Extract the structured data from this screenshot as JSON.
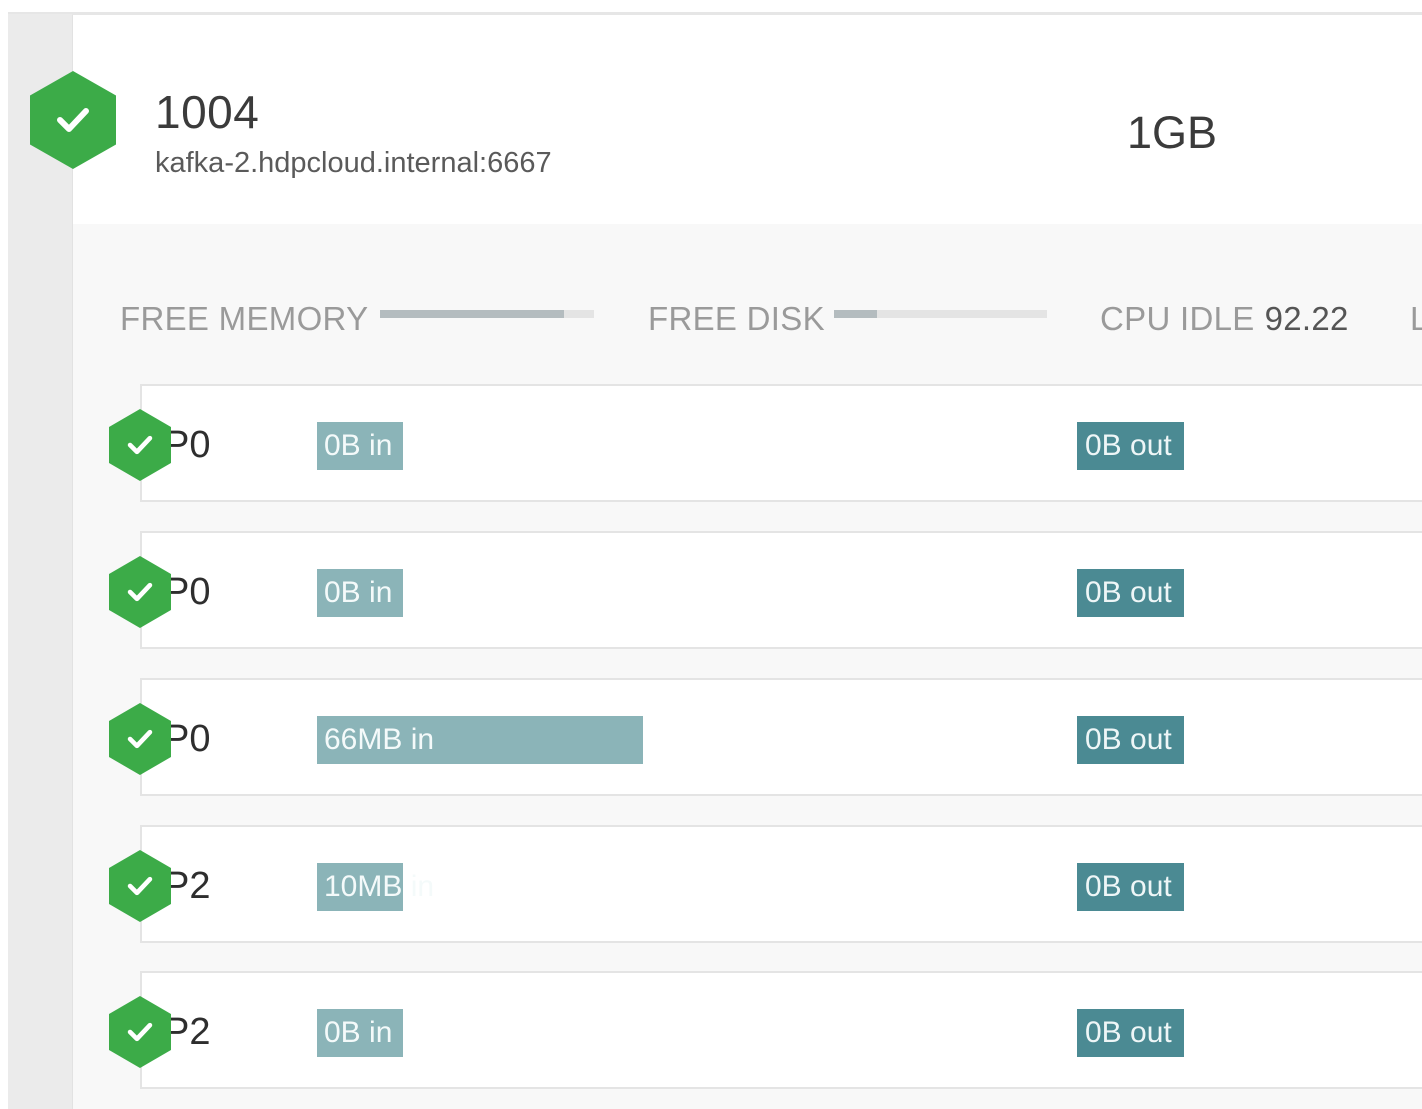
{
  "broker": {
    "id": "1004",
    "host": "kafka-2.hdpcloud.internal:6667",
    "memory": "1GB",
    "status": "ok"
  },
  "metrics": {
    "free_memory_label": "FREE MEMORY",
    "free_memory_fraction": 0.86,
    "free_disk_label": "FREE DISK",
    "free_disk_fraction": 0.2,
    "cpu_idle_label": "CPU IDLE",
    "cpu_idle_value": "92.22",
    "next_label_partial": "L"
  },
  "partitions": [
    {
      "name": "P0",
      "in_label": "0B in",
      "in_fraction": 0.0,
      "out_label": "0B out"
    },
    {
      "name": "P0",
      "in_label": "0B in",
      "in_fraction": 0.0,
      "out_label": "0B out"
    },
    {
      "name": "P0",
      "in_label": "66MB in",
      "in_fraction": 1.0,
      "out_label": "0B out"
    },
    {
      "name": "P2",
      "in_label": "10MB in",
      "in_fraction": 0.15,
      "out_label": "0B out"
    },
    {
      "name": "P2",
      "in_label": "0B in",
      "in_fraction": 0.0,
      "out_label": "0B out"
    }
  ],
  "colors": {
    "status_ok": "#3cab48",
    "bytes_in": "#8bb4b8",
    "bytes_out": "#4b8a93"
  }
}
